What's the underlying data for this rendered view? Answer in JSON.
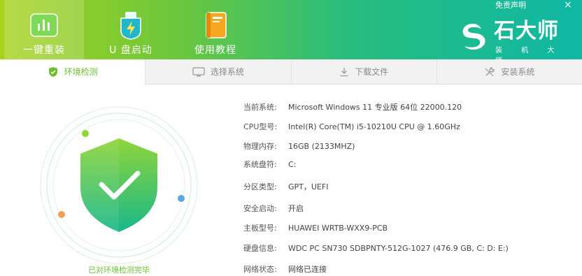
{
  "header": {
    "nav": [
      {
        "label": "一键重装",
        "icon": "bar-chart-icon",
        "active": true
      },
      {
        "label": "U 盘启动",
        "icon": "usb-flash-icon",
        "active": false
      },
      {
        "label": "使用教程",
        "icon": "book-icon",
        "active": false
      }
    ],
    "disclaimer": "免责声明",
    "close": "×",
    "logo": {
      "name": "石大师",
      "subtitle": "装 机 大 师"
    }
  },
  "tabs": [
    {
      "label": "环境检测",
      "icon": "shield-check-icon",
      "active": true
    },
    {
      "label": "选择系统",
      "icon": "monitor-icon",
      "active": false
    },
    {
      "label": "下载文件",
      "icon": "download-icon",
      "active": false
    },
    {
      "label": "安装系统",
      "icon": "wrench-icon",
      "active": false
    }
  ],
  "detect": {
    "status": "已对环境检测完毕"
  },
  "system_info": [
    {
      "key": "当前系统:",
      "value": "Microsoft Windows 11 专业版 64位 22000.120"
    },
    {
      "key": "CPU型号:",
      "value": "Intel(R) Core(TM) i5-10210U CPU @ 1.60GHz"
    },
    {
      "key": "物理内存:",
      "value": "16GB (2133MHZ)"
    },
    {
      "key": "系统盘符:",
      "value": "C:"
    },
    {
      "key": "分区类型:",
      "value": "GPT，UEFI"
    },
    {
      "key": "安全启动:",
      "value": "开启"
    },
    {
      "key": "主板型号:",
      "value": "HUAWEI WRTB-WXX9-PCB"
    },
    {
      "key": "硬盘信息:",
      "value": "WDC PC SN730 SDBPNTY-512G-1027  (476.9 GB, C: D: E:)"
    },
    {
      "key": "网络状态:",
      "value": "网络已连接"
    }
  ],
  "colors": {
    "accent": "#6abf2f",
    "header_start": "#a9d21c",
    "header_end": "#0fb7a4"
  }
}
